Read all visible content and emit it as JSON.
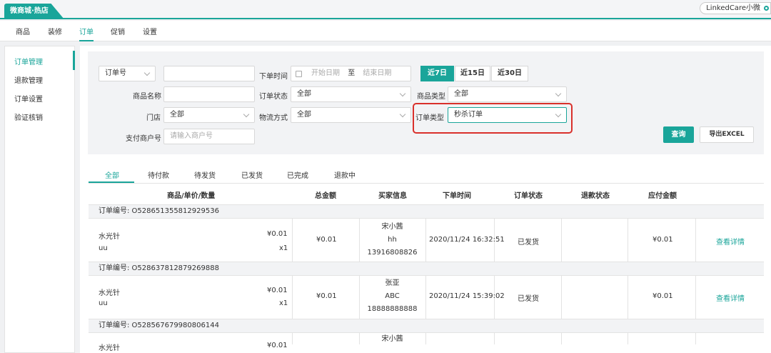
{
  "shop_tab": "微商城·热店",
  "user_label": "LinkedCare小微",
  "nav": [
    "商品",
    "装修",
    "订单",
    "促销",
    "设置"
  ],
  "sidebar": [
    "订单管理",
    "退款管理",
    "订单设置",
    "验证核销"
  ],
  "filter": {
    "order_no_select": "订单号",
    "order_time_label": "下单时间",
    "start_placeholder": "开始日期",
    "to": "至",
    "end_placeholder": "结束日期",
    "ranges": [
      "近7日",
      "近15日",
      "近30日"
    ],
    "product_name_label": "商品名称",
    "order_status_label": "订单状态",
    "order_status_value": "全部",
    "product_type_label": "商品类型",
    "product_type_value": "全部",
    "store_label": "门店",
    "store_value": "全部",
    "logistics_label": "物流方式",
    "logistics_value": "全部",
    "order_type_label": "订单类型",
    "order_type_value": "秒杀订单",
    "merchant_label": "支付商户号",
    "merchant_placeholder": "请输入商户号",
    "query": "查询",
    "export": "导出EXCEL"
  },
  "order_tabs": [
    "全部",
    "待付款",
    "待发货",
    "已发货",
    "已完成",
    "退款中"
  ],
  "columns": [
    "商品/单价/数量",
    "总金额",
    "买家信息",
    "下单时间",
    "订单状态",
    "退款状态",
    "应付金额"
  ],
  "orders": [
    {
      "no": "订单编号: O528651355812929536",
      "product": "水光针",
      "spec": "uu",
      "price": "¥0.01",
      "qty": "x1",
      "total": "¥0.01",
      "buyer": [
        "宋小茜",
        "hh",
        "13916808826"
      ],
      "time": "2020/11/24 16:32:51",
      "status": "已发货",
      "refund": "",
      "payable": "¥0.01",
      "action": "查看详情"
    },
    {
      "no": "订单编号: O528637812879269888",
      "product": "水光针",
      "spec": "uu",
      "price": "¥0.01",
      "qty": "x1",
      "total": "¥0.01",
      "buyer": [
        "张亚",
        "ABC",
        "18888888888"
      ],
      "time": "2020/11/24 15:39:02",
      "status": "已发货",
      "refund": "",
      "payable": "¥0.01",
      "action": "查看详情"
    },
    {
      "no": "订单编号: O528567679980806144",
      "product": "水光针",
      "spec": "",
      "price": "¥0.01",
      "qty": "",
      "total": "",
      "buyer": [
        "宋小茜"
      ],
      "time": "",
      "status": "",
      "refund": "",
      "payable": "",
      "action": ""
    }
  ]
}
